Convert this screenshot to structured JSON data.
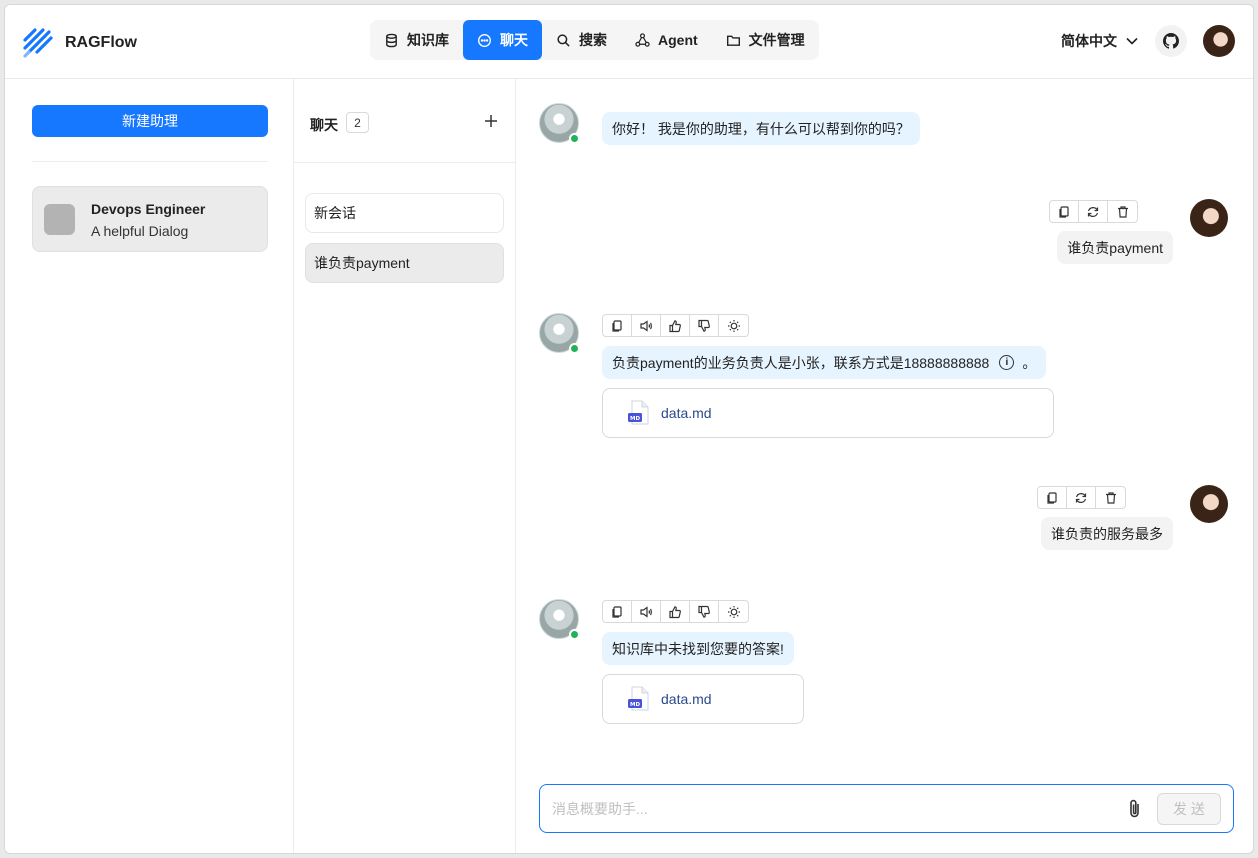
{
  "app": {
    "name": "RAGFlow"
  },
  "nav": [
    {
      "label": "知识库",
      "icon": "database-icon"
    },
    {
      "label": "聊天",
      "icon": "chat-icon",
      "active": true
    },
    {
      "label": "搜索",
      "icon": "search-icon"
    },
    {
      "label": "Agent",
      "icon": "graph-icon"
    },
    {
      "label": "文件管理",
      "icon": "folder-icon"
    }
  ],
  "header": {
    "language": "简体中文"
  },
  "colors": {
    "accent": "#1677ff",
    "bot_bubble": "#e6f4ff",
    "user_bubble": "#f3f3f3",
    "online": "#22b15a"
  },
  "assistants": {
    "new_button": "新建助理",
    "items": [
      {
        "name": "Devops Engineer",
        "description": "A helpful Dialog"
      }
    ]
  },
  "conversations": {
    "title": "聊天",
    "count": "2",
    "items": [
      {
        "label": "新会话",
        "selected": false
      },
      {
        "label": "谁负责payment",
        "selected": true
      }
    ]
  },
  "messages": [
    {
      "role": "assistant",
      "text": "你好！ 我是你的助理，有什么可以帮到你的吗？"
    },
    {
      "role": "user",
      "text": "谁负责payment"
    },
    {
      "role": "assistant",
      "text": "负责payment的业务负责人是小张，联系方式是18888888888",
      "suffix": "。",
      "reference": "data.md",
      "ref_badge": "MD"
    },
    {
      "role": "user",
      "text": "谁负责的服务最多"
    },
    {
      "role": "assistant",
      "text": "知识库中未找到您要的答案!",
      "reference": "data.md",
      "ref_badge": "MD"
    }
  ],
  "composer": {
    "placeholder": "消息概要助手...",
    "send_label": "发 送"
  }
}
